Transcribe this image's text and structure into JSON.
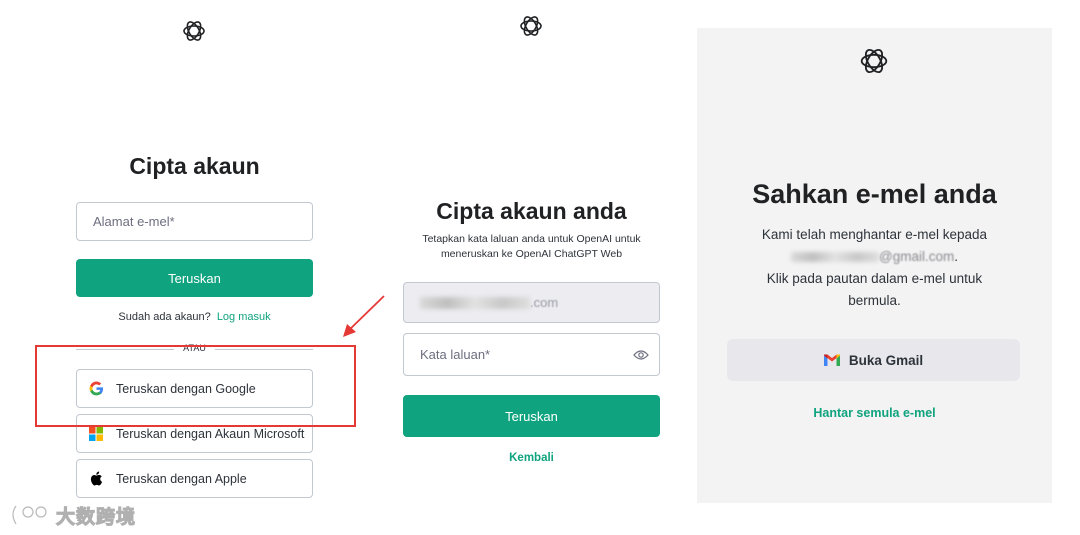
{
  "panel1": {
    "title": "Cipta akaun",
    "email_placeholder": "Alamat e-mel*",
    "continue_label": "Teruskan",
    "have_account_text": "Sudah ada akaun?",
    "login_link": "Log masuk",
    "or_divider": "ATAU",
    "social": [
      {
        "label": "Teruskan dengan Google",
        "icon": "google-icon"
      },
      {
        "label": "Teruskan dengan Akaun Microsoft",
        "icon": "microsoft-icon"
      },
      {
        "label": "Teruskan dengan Apple",
        "icon": "apple-icon"
      }
    ]
  },
  "panel2": {
    "title": "Cipta akaun anda",
    "subtitle_line1": "Tetapkan kata laluan anda untuk OpenAI untuk",
    "subtitle_line2": "meneruskan ke OpenAI ChatGPT Web",
    "email_visible_suffix": ".com",
    "password_placeholder": "Kata laluan*",
    "continue_label": "Teruskan",
    "back_link": "Kembali"
  },
  "panel3": {
    "title": "Sahkan e-mel anda",
    "line1": "Kami telah menghantar e-mel kepada",
    "email_visible_fragment": "@gmail.com",
    "line3": "Klik pada pautan dalam e-mel untuk",
    "line4": "bermula.",
    "open_gmail_label": "Buka Gmail",
    "resend_link": "Hantar semula e-mel"
  },
  "watermark": {
    "text": "大数跨境"
  },
  "colors": {
    "accent": "#10a37f",
    "highlight": "#e53935",
    "panel_bg": "#f3f3f3"
  }
}
